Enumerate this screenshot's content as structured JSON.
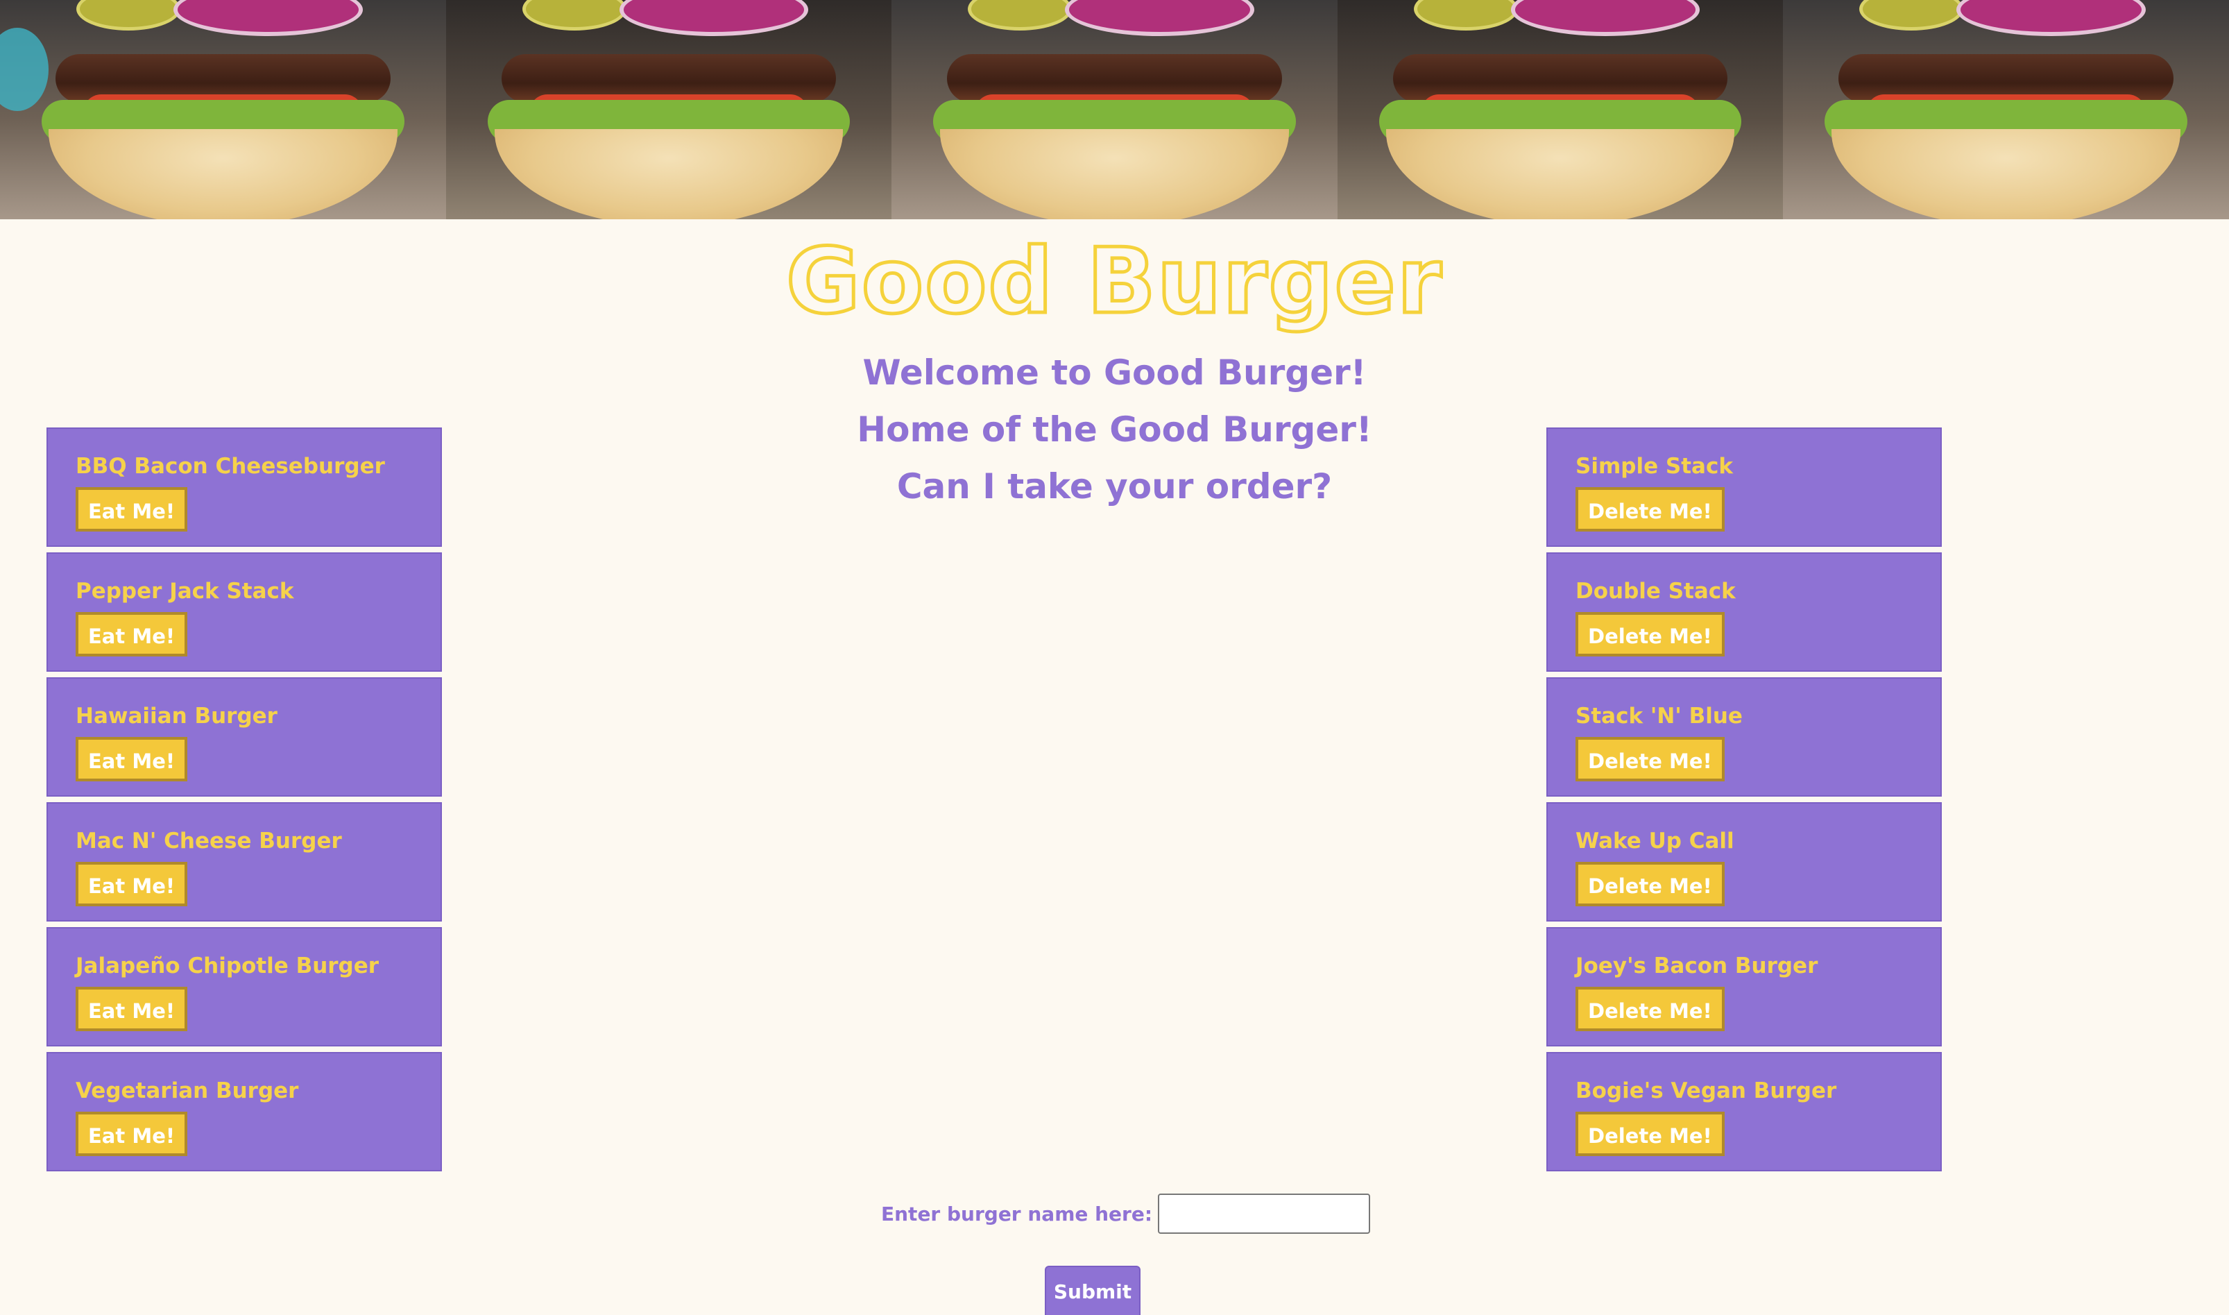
{
  "banner": {
    "image": "burger-banner-image",
    "tiles": 5
  },
  "header": {
    "title": "Good Burger",
    "welcome_lines": [
      "Welcome to Good Burger!",
      "Home of the Good Burger!",
      "Can I take your order?"
    ]
  },
  "left_column": {
    "button_label": "Eat Me!",
    "items": [
      "BBQ Bacon Cheeseburger",
      "Pepper Jack Stack",
      "Hawaiian Burger",
      "Mac N' Cheese Burger",
      "Jalapeño Chipotle Burger",
      "Vegetarian Burger"
    ]
  },
  "right_column": {
    "button_label": "Delete Me!",
    "items": [
      "Simple Stack",
      "Double Stack",
      "Stack 'N' Blue",
      "Wake Up Call",
      "Joey's Bacon Burger",
      "Bogie's Vegan Burger"
    ]
  },
  "form": {
    "label": "Enter burger name here:",
    "input_value": "",
    "submit_label": "Submit"
  },
  "colors": {
    "background": "#fdf9f1",
    "accent_purple": "#8e72d4",
    "accent_yellow": "#f4c83a",
    "title_outline": "#f5d23b"
  }
}
